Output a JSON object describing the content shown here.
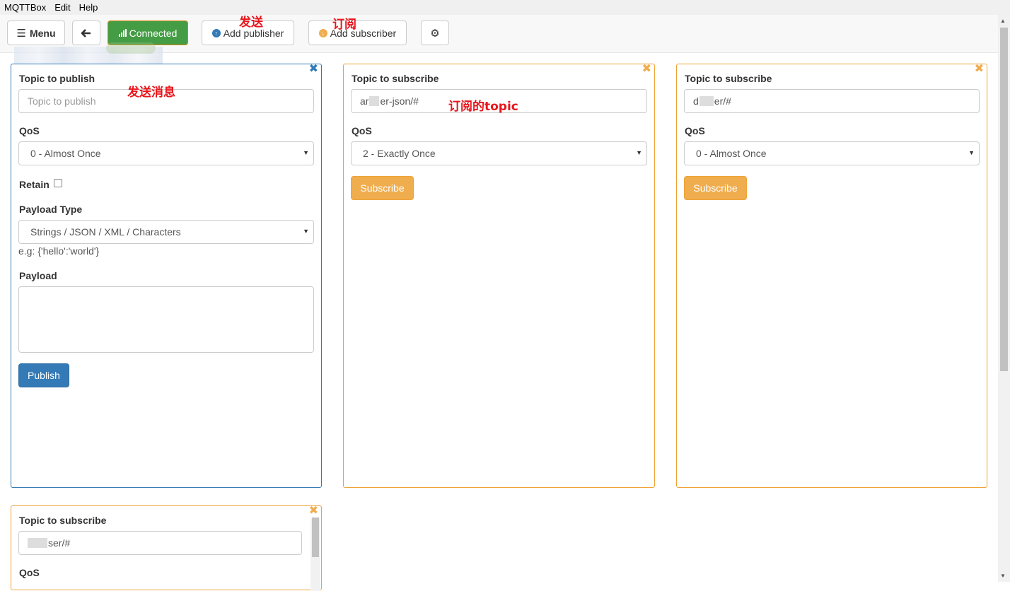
{
  "menubar": {
    "items": [
      "MQTTBox",
      "Edit",
      "Help"
    ]
  },
  "toolbar": {
    "menu_label": "Menu",
    "back_icon": "arrow-left-icon",
    "connected_label": "Connected",
    "add_publisher_label": "Add publisher",
    "add_subscriber_label": "Add subscriber",
    "settings_icon": "gear-icon"
  },
  "annotations": {
    "send": "发送",
    "subscribe": "订阅",
    "send_message": "发送消息",
    "subscribed_topic": "订阅的topic"
  },
  "publisher": {
    "topic_label": "Topic to publish",
    "topic_placeholder": "Topic to publish",
    "qos_label": "QoS",
    "qos_value": "0 - Almost Once",
    "retain_label": "Retain",
    "retain_checked": false,
    "payload_type_label": "Payload Type",
    "payload_type_value": "Strings / JSON / XML / Characters",
    "payload_type_help": "e.g: {'hello':'world'}",
    "payload_label": "Payload",
    "payload_value": "",
    "publish_label": "Publish"
  },
  "subscribers": [
    {
      "topic_label": "Topic to subscribe",
      "topic_prefix": "ar",
      "topic_suffix": "er-json/#",
      "qos_label": "QoS",
      "qos_value": "2 - Exactly Once",
      "subscribe_label": "Subscribe"
    },
    {
      "topic_label": "Topic to subscribe",
      "topic_prefix": "d",
      "topic_suffix": "er/#",
      "qos_label": "QoS",
      "qos_value": "0 - Almost Once",
      "subscribe_label": "Subscribe"
    },
    {
      "topic_label": "Topic to subscribe",
      "topic_prefix": "",
      "topic_suffix": "ser/#",
      "qos_label": "QoS"
    }
  ],
  "colors": {
    "publisher_border": "#337ab7",
    "subscriber_border": "#eea236",
    "connected_bg": "#449d44",
    "annotation": "#e8161c"
  }
}
